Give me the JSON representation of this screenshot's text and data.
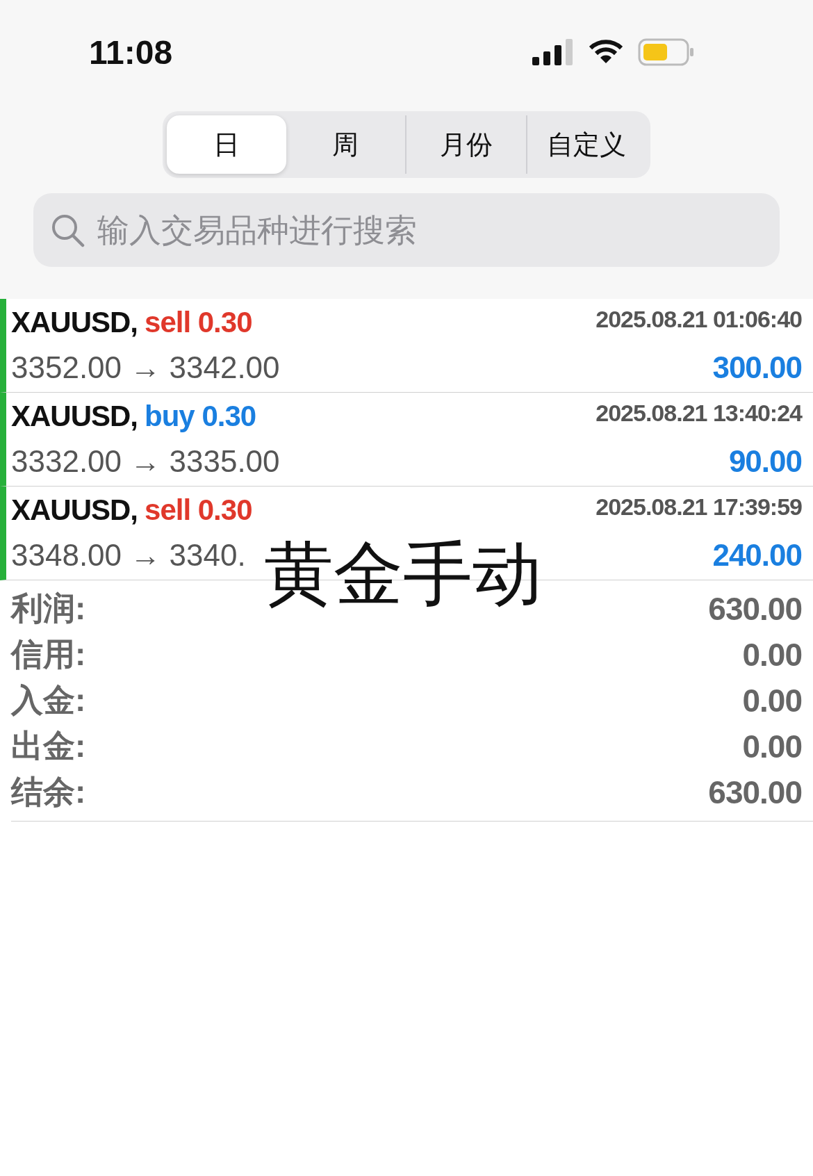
{
  "status_bar": {
    "time": "11:08"
  },
  "tabs": [
    {
      "label": "日",
      "selected": true
    },
    {
      "label": "周",
      "selected": false
    },
    {
      "label": "月份",
      "selected": false
    },
    {
      "label": "自定义",
      "selected": false
    }
  ],
  "search": {
    "placeholder": "输入交易品种进行搜索"
  },
  "trades": [
    {
      "symbol": "XAUUSD,",
      "side": "sell",
      "volume": "0.30",
      "prices": "3352.00 → 3342.00",
      "time": "2025.08.21 01:06:40",
      "profit": "300.00"
    },
    {
      "symbol": "XAUUSD,",
      "side": "buy",
      "volume": "0.30",
      "prices": "3332.00 → 3335.00",
      "time": "2025.08.21 13:40:24",
      "profit": "90.00"
    },
    {
      "symbol": "XAUUSD,",
      "side": "sell",
      "volume": "0.30",
      "prices": "3348.00 → 3340.",
      "time": "2025.08.21 17:39:59",
      "profit": "240.00"
    }
  ],
  "overlay_caption": "黄金手动",
  "summary": [
    {
      "label": "利润:",
      "value": "630.00"
    },
    {
      "label": "信用:",
      "value": "0.00"
    },
    {
      "label": "入金:",
      "value": "0.00"
    },
    {
      "label": "出金:",
      "value": "0.00"
    },
    {
      "label": "结余:",
      "value": "630.00"
    }
  ]
}
